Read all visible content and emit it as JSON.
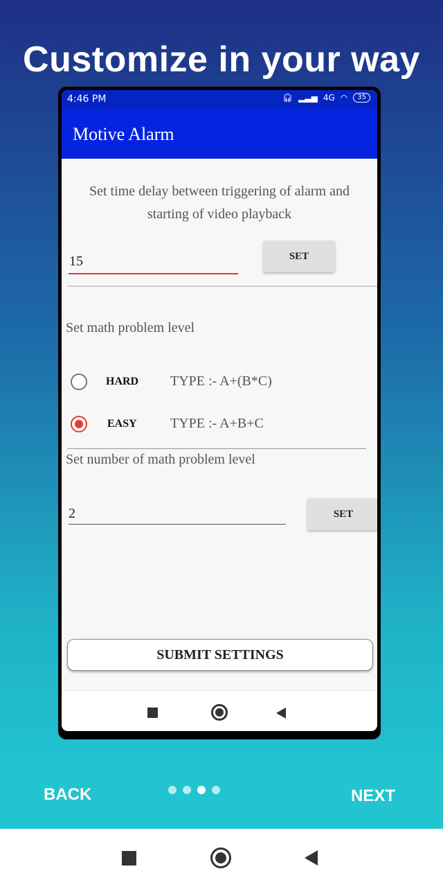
{
  "headline": "Customize in your way",
  "status_bar": {
    "time": "4:46 PM",
    "network": "4G",
    "battery": "35"
  },
  "app": {
    "title": "Motive Alarm"
  },
  "delay": {
    "description_line1": "Set time delay between triggering of alarm and",
    "description_line2": "starting of video playback",
    "value": "15",
    "set_label": "SET"
  },
  "math_level": {
    "heading": "Set math problem level",
    "options": [
      {
        "name": "HARD",
        "type": "TYPE :- A+(B*C)",
        "selected": false
      },
      {
        "name": "EASY",
        "type": "TYPE :- A+B+C",
        "selected": true
      }
    ]
  },
  "problem_count": {
    "heading": "Set number of math problem level",
    "value": "2",
    "set_label": "SET"
  },
  "submit_label": "SUBMIT SETTINGS",
  "onboarding": {
    "back_label": "BACK",
    "next_label": "NEXT",
    "pages": 4,
    "current_page": 3
  },
  "colors": {
    "accent": "#e53935",
    "app_bar": "#0524e0",
    "onboard_bar": "#22c5cf"
  }
}
